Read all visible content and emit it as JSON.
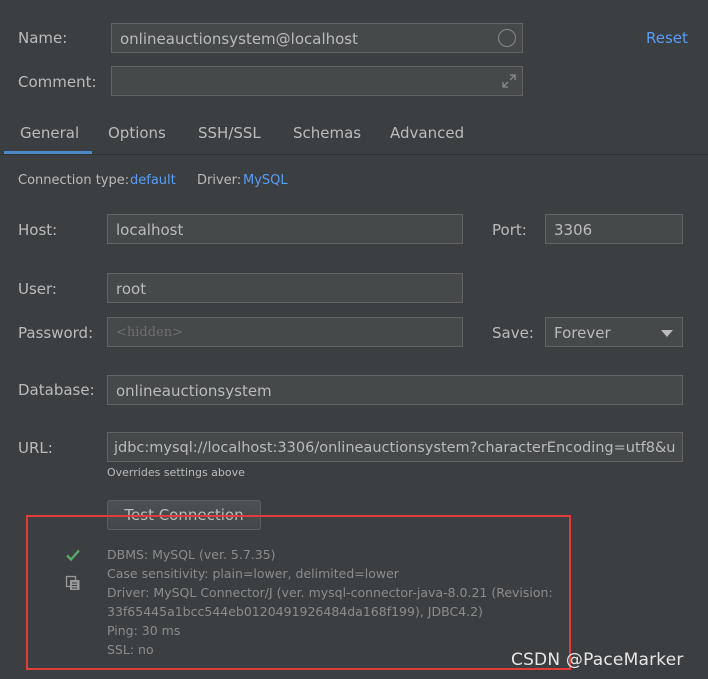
{
  "header": {
    "name_label": "Name:",
    "name_value": "onlineauctionsystem@localhost",
    "comment_label": "Comment:",
    "comment_value": "",
    "reset_label": "Reset"
  },
  "tabs": [
    {
      "label": "General",
      "active": true
    },
    {
      "label": "Options",
      "active": false
    },
    {
      "label": "SSH/SSL",
      "active": false
    },
    {
      "label": "Schemas",
      "active": false
    },
    {
      "label": "Advanced",
      "active": false
    }
  ],
  "general": {
    "connection_type_label": "Connection type:",
    "connection_type_value": "default",
    "driver_label": "Driver:",
    "driver_value": "MySQL",
    "host_label": "Host:",
    "host_value": "localhost",
    "port_label": "Port:",
    "port_value": "3306",
    "user_label": "User:",
    "user_value": "root",
    "password_label": "Password:",
    "password_placeholder": "<hidden>",
    "save_label": "Save:",
    "save_value": "Forever",
    "database_label": "Database:",
    "database_value": "onlineauctionsystem",
    "url_label": "URL:",
    "url_value": "jdbc:mysql://localhost:3306/onlineauctionsystem?characterEncoding=utf8&u",
    "url_note": "Overrides settings above",
    "test_button": "Test Connection"
  },
  "result": {
    "lines": [
      "DBMS: MySQL (ver. 5.7.35)",
      "Case sensitivity: plain=lower, delimited=lower",
      "Driver: MySQL Connector/J (ver. mysql-connector-java-8.0.21 (Revision:",
      "33f65445a1bcc544eb0120491926484da168f199), JDBC4.2)",
      "Ping: 30 ms",
      "SSL: no"
    ],
    "status_icon": "check-icon",
    "copy_icon": "copy-icon",
    "highlight_color": "#e03c3c",
    "success_color": "#59a869"
  },
  "watermark": "CSDN @PaceMarker",
  "colors": {
    "background": "#3c3f41",
    "field_bg": "#45494a",
    "link": "#589df6",
    "tab_underline": "#4a88c7"
  }
}
